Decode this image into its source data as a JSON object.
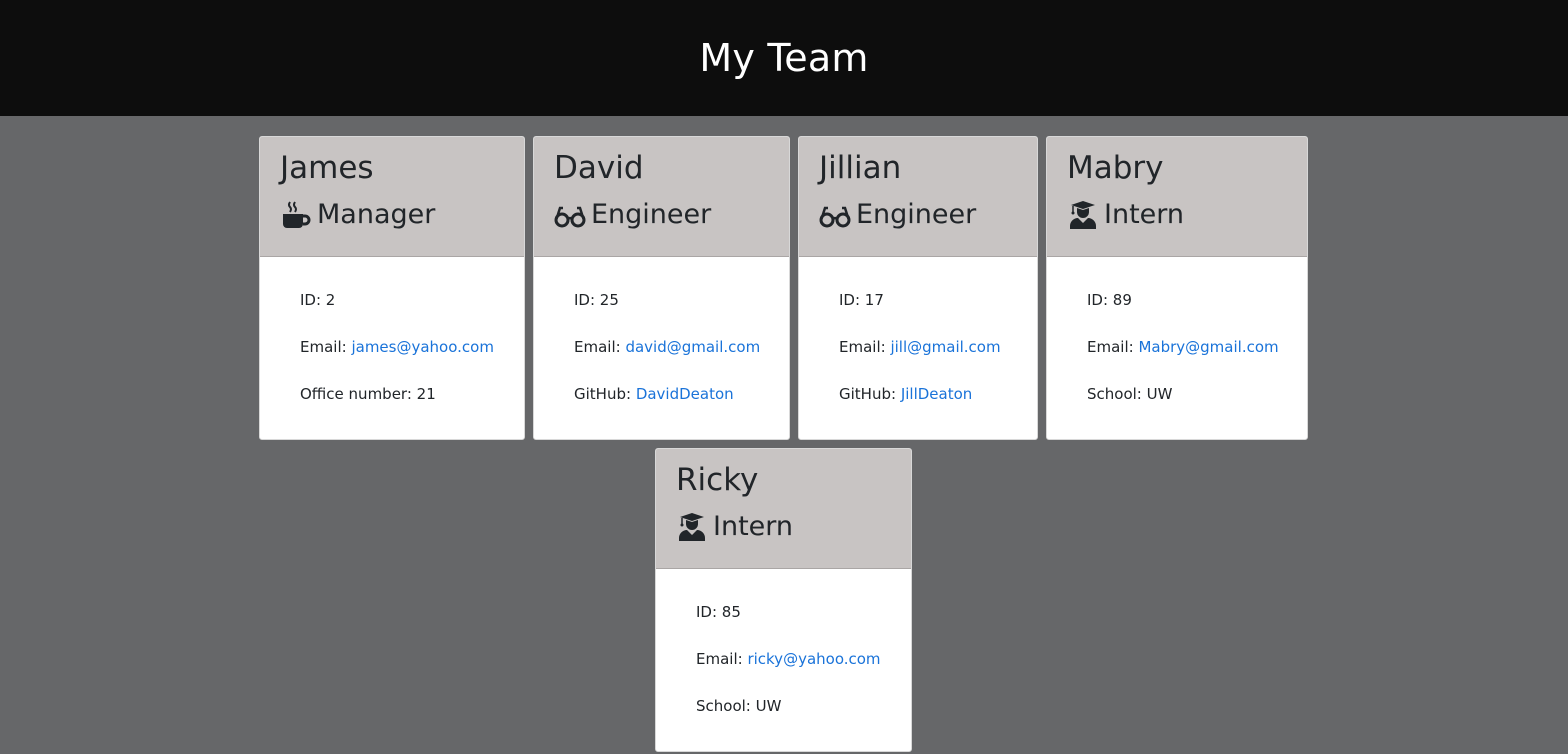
{
  "header": {
    "title": "My Team"
  },
  "labels": {
    "id": "ID: ",
    "email": "Email: ",
    "office": "Office number: ",
    "github": "GitHub: ",
    "school": "School: "
  },
  "members": [
    {
      "name": "James",
      "role": "Manager",
      "icon": "coffee-mug-icon",
      "id": "2",
      "email": "james@yahoo.com",
      "extra": "21"
    },
    {
      "name": "David",
      "role": "Engineer",
      "icon": "glasses-icon",
      "id": "25",
      "email": "david@gmail.com",
      "extra": "DavidDeaton"
    },
    {
      "name": "Jillian",
      "role": "Engineer",
      "icon": "glasses-icon",
      "id": "17",
      "email": "jill@gmail.com",
      "extra": "JillDeaton"
    },
    {
      "name": "Mabry",
      "role": "Intern",
      "icon": "graduate-icon",
      "id": "89",
      "email": "Mabry@gmail.com",
      "extra": "UW"
    },
    {
      "name": "Ricky",
      "role": "Intern",
      "icon": "graduate-icon",
      "id": "85",
      "email": "ricky@yahoo.com",
      "extra": "UW"
    }
  ]
}
